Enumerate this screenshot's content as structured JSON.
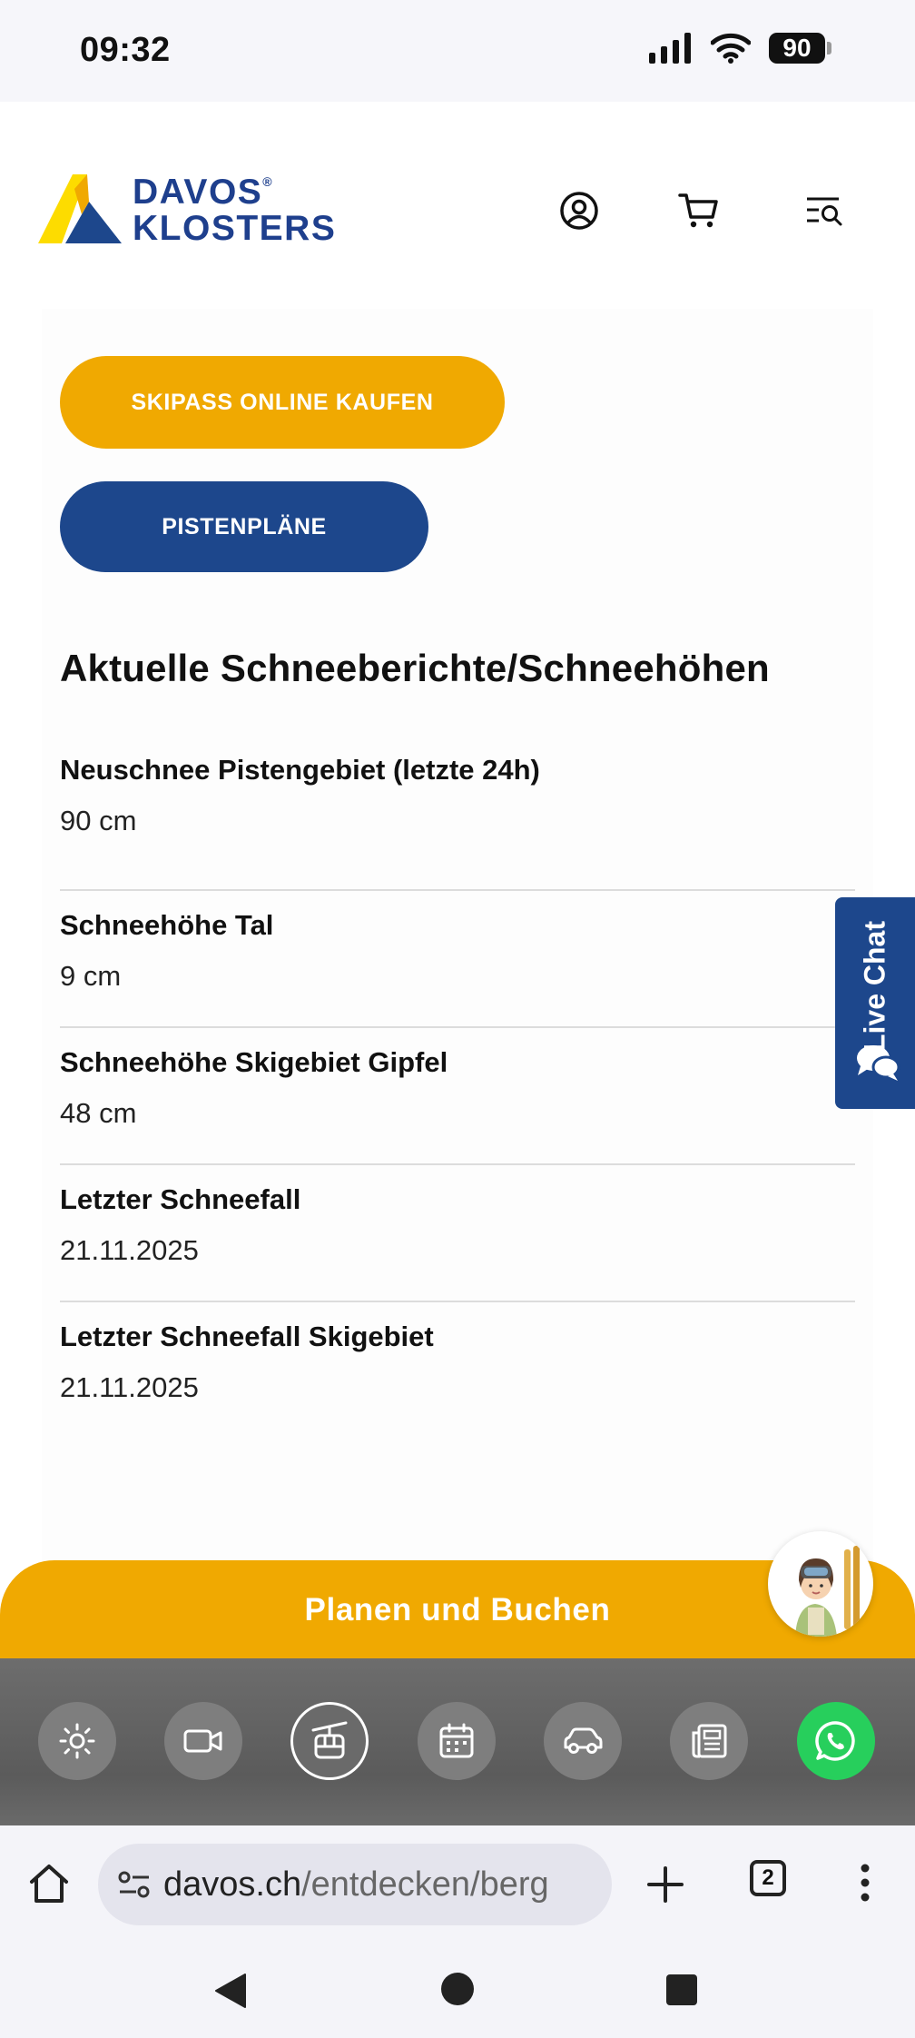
{
  "status_bar": {
    "time": "09:32",
    "battery": "90"
  },
  "header": {
    "logo_line1": "DAVOS",
    "logo_reg": "®",
    "logo_line2": "KLOSTERS"
  },
  "buttons": {
    "skipass": "SKIPASS ONLINE KAUFEN",
    "pistenplaene": "PISTENPLÄNE"
  },
  "section_title": "Aktuelle Schneeberichte/Schneehöhen",
  "reports": [
    {
      "label": "Neuschnee Pistengebiet (letzte 24h)",
      "value": "90 cm"
    },
    {
      "label": "Schneehöhe Tal",
      "value": "9 cm"
    },
    {
      "label": "Schneehöhe Skigebiet Gipfel",
      "value": "48 cm"
    },
    {
      "label": "Letzter Schneefall",
      "value": "21.11.2025"
    },
    {
      "label": "Letzter Schneefall Skigebiet",
      "value": "21.11.2025"
    }
  ],
  "live_chat": "Live Chat",
  "plan_bar": "Planen und Buchen",
  "quick_nav": [
    "weather-icon",
    "webcam-icon",
    "cable-car-icon",
    "calendar-icon",
    "car-icon",
    "news-icon",
    "whatsapp-icon"
  ],
  "browser": {
    "url_domain": "davos.ch",
    "url_path": "/entdecken/berg",
    "tab_count": "2"
  },
  "colors": {
    "brand_yellow": "#f0a901",
    "brand_blue": "#1d478c",
    "whatsapp_green": "#27cf5c"
  }
}
